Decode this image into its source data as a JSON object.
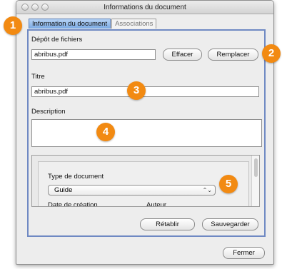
{
  "window": {
    "title": "Informations du document"
  },
  "tabs": [
    {
      "label": "Information du document"
    },
    {
      "label": "Associations"
    }
  ],
  "upload": {
    "label": "Dépôt de fichiers",
    "file_value": "abribus.pdf",
    "clear_label": "Effacer",
    "replace_label": "Remplacer"
  },
  "title_field": {
    "label": "Titre",
    "value": "abribus.pdf"
  },
  "description_field": {
    "label": "Description",
    "value": ""
  },
  "doc_type": {
    "label": "Type de document",
    "selected": "Guide",
    "created_label": "Date de création",
    "author_label": "Auteur"
  },
  "actions": {
    "reset_label": "Rétablir",
    "save_label": "Sauvegarder",
    "close_label": "Fermer"
  },
  "callouts": [
    "1",
    "2",
    "3",
    "4",
    "5"
  ],
  "colors": {
    "callout": "#f28a12",
    "active_tab": "#7aa9e3",
    "panel_border": "#6f89c3"
  }
}
